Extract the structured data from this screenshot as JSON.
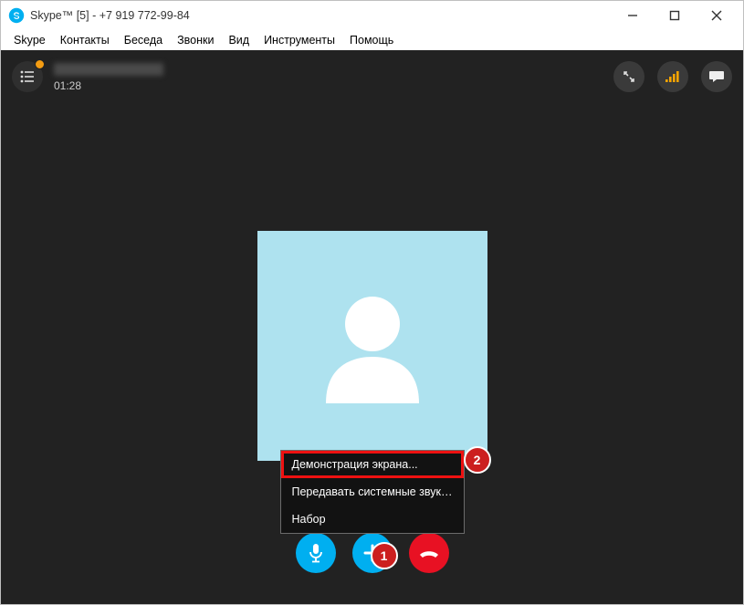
{
  "window": {
    "title": "Skype™ [5] - +7 919 772-99-84"
  },
  "menubar": [
    "Skype",
    "Контакты",
    "Беседа",
    "Звонки",
    "Вид",
    "Инструменты",
    "Помощь"
  ],
  "call": {
    "contact_name": "",
    "timer": "01:28"
  },
  "popup": {
    "items": [
      "Демонстрация экрана...",
      "Передавать системные звуки...",
      "Набор"
    ],
    "highlighted_index": 0
  },
  "annotations": {
    "badge1": "1",
    "badge2": "2"
  },
  "colors": {
    "accent_blue": "#00aff0",
    "hangup_red": "#e81123",
    "avatar_bg": "#aee2ef",
    "signal": "#f7a400"
  }
}
